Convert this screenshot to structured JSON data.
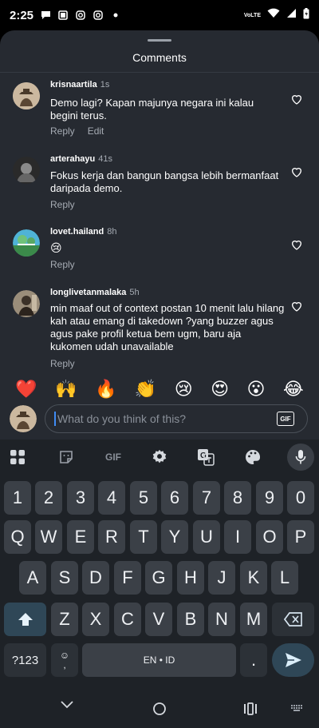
{
  "status_bar": {
    "time": "2:25",
    "network": "VoLTE",
    "icons": [
      "chat-bubble-icon",
      "square-icon",
      "instagram-icon",
      "instagram-icon",
      "dot-icon",
      "wifi-icon",
      "signal-icon",
      "battery-icon"
    ]
  },
  "sheet": {
    "title": "Comments"
  },
  "comments": [
    {
      "user": "krisnaartila",
      "ago": "1s",
      "text": "Demo lagi? Kapan majunya negara ini kalau begini terus.",
      "reply": "Reply",
      "edit": "Edit"
    },
    {
      "user": "arterahayu",
      "ago": "41s",
      "text": "Fokus kerja dan bangun bangsa lebih bermanfaat daripada demo.",
      "reply": "Reply"
    },
    {
      "user": "lovet.hailand",
      "ago": "8h",
      "text": "😢",
      "reply": "Reply"
    },
    {
      "user": "longlivetanmalaka",
      "ago": "5h",
      "text": "min maaf out of context postan 10 menit lalu hilang kah atau emang di takedown ?yang buzzer agus agus pake profil ketua bem ugm, baru aja kukomen udah unavailable",
      "reply": "Reply"
    }
  ],
  "reactions": [
    "❤️",
    "🙌",
    "🔥",
    "👏",
    "😢",
    "😍",
    "😮",
    "😂"
  ],
  "composer": {
    "placeholder": "What do you think of this?",
    "gif_label": "GIF"
  },
  "keyboard": {
    "toolbar_gif": "GIF",
    "row_numbers": [
      "1",
      "2",
      "3",
      "4",
      "5",
      "6",
      "7",
      "8",
      "9",
      "0"
    ],
    "row_1": [
      "Q",
      "W",
      "E",
      "R",
      "T",
      "Y",
      "U",
      "I",
      "O",
      "P"
    ],
    "row_2": [
      "A",
      "S",
      "D",
      "F",
      "G",
      "H",
      "J",
      "K",
      "L"
    ],
    "row_3": [
      "Z",
      "X",
      "C",
      "V",
      "B",
      "N",
      "M"
    ],
    "symbols_label": "?123",
    "emoji_comma": "☺\n,",
    "space_label": "EN • ID",
    "period": "."
  },
  "colors": {
    "sheet_bg": "#262a31",
    "keyboard_bg": "#1e2227",
    "accent_blue": "#3f8cf5",
    "muted_text": "#a5abb3"
  }
}
